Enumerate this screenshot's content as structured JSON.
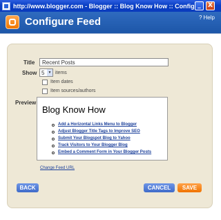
{
  "window": {
    "title": "http://www.blogger.com - Blogger :: Blog Know How :: Configure Feed - Mi...",
    "minimize_glyph": "_",
    "close_glyph": "X"
  },
  "header": {
    "title": "Configure Feed",
    "help_label": "Help",
    "help_glyph": "?",
    "logo_icon": "blogger-logo"
  },
  "form": {
    "title_label": "Title",
    "title_value": "Recent Posts",
    "show_label": "Show",
    "show_value": "5",
    "show_arrow": "▼",
    "items_label": "items",
    "item_dates_label": "Item dates",
    "item_sources_label": "Item sources/authors",
    "preview_label": "Preview"
  },
  "preview": {
    "blog_title": "Blog Know How",
    "links": [
      "Add a Horizontal Links Menu to Blogger",
      "Adjust Blogger Title Tags to Improve SEO",
      "Submit Your Blogspot Blog to Yahoo",
      "Track Visitors to Your Blogger Blog",
      "Embed a Comment Form in Your Blogger Posts"
    ]
  },
  "change_feed_url": "Change Feed URL",
  "buttons": {
    "back": "BACK",
    "cancel": "CANCEL",
    "save": "SAVE"
  },
  "colors": {
    "titlebar": "#0a3fc4",
    "header": "#2f6bbf",
    "panel": "#eee8d6",
    "link": "#1a3f9a",
    "save": "#f07300",
    "blue_button": "#3f6bc9"
  }
}
